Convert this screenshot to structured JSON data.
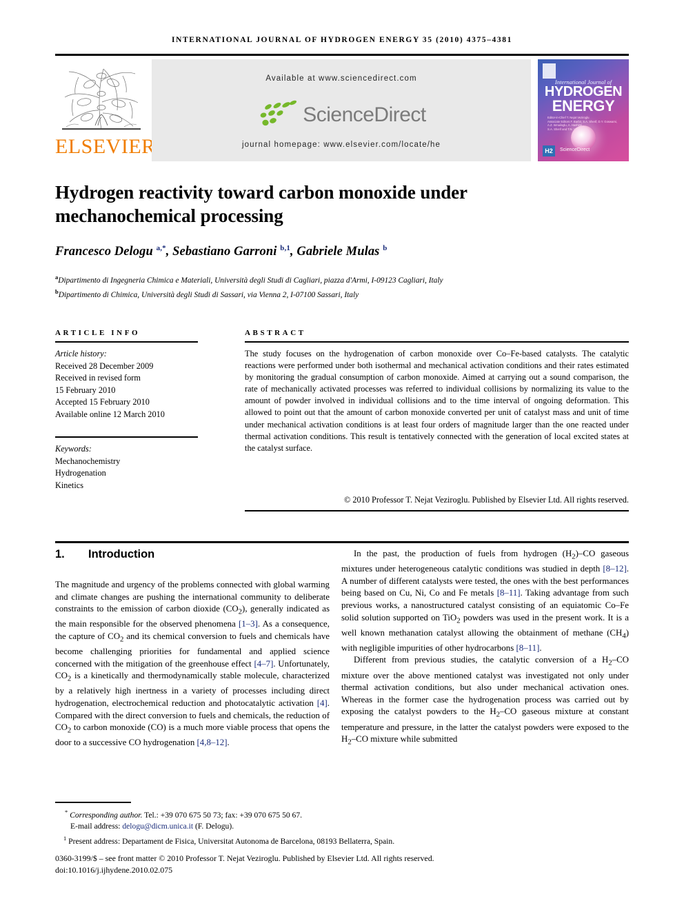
{
  "running_head": "International Journal of Hydrogen Energy 35 (2010) 4375–4381",
  "masthead": {
    "publisher_name": "ELSEVIER",
    "available_at": "Available at www.sciencedirect.com",
    "sciencedirect_label": "ScienceDirect",
    "journal_homepage": "journal homepage: www.elsevier.com/locate/he",
    "cover": {
      "line1": "International Journal of",
      "line2": "HYDROGEN",
      "line3": "ENERGY",
      "editors": "Editor-in-Chief  T. Nejat Veziroglu\nAssociate Editors  F. Barbir, S.A. Sherif, D.Y. Goswami,\nA.Z. Ismailoglu, A. Hashimi,\nS.A. Sherif and T.N. Veziroglu",
      "h2_badge": "H2",
      "sciencedirect": "ScienceDirect"
    }
  },
  "article": {
    "title": "Hydrogen reactivity toward carbon monoxide under mechanochemical processing",
    "authors_html": "Francesco Delogu <sup>a,*</sup>, Sebastiano Garroni <sup>b,1</sup>, Gabriele Mulas <sup>b</sup>",
    "affiliations": [
      {
        "marker": "a",
        "text": "Dipartimento di Ingegneria Chimica e Materiali, Università degli Studi di Cagliari, piazza d'Armi, I-09123 Cagliari, Italy"
      },
      {
        "marker": "b",
        "text": "Dipartimento di Chimica, Università degli Studi di Sassari, via Vienna 2, I-07100 Sassari, Italy"
      }
    ]
  },
  "article_info": {
    "heading": "Article info",
    "history_label": "Article history:",
    "history": [
      "Received 28 December 2009",
      "Received in revised form",
      "15 February 2010",
      "Accepted 15 February 2010",
      "Available online 12 March 2010"
    ],
    "keywords_label": "Keywords:",
    "keywords": [
      "Mechanochemistry",
      "Hydrogenation",
      "Kinetics"
    ]
  },
  "abstract": {
    "heading": "Abstract",
    "text": "The study focuses on the hydrogenation of carbon monoxide over Co–Fe-based catalysts. The catalytic reactions were performed under both isothermal and mechanical activation conditions and their rates estimated by monitoring the gradual consumption of carbon monoxide. Aimed at carrying out a sound comparison, the rate of mechanically activated processes was referred to individual collisions by normalizing its value to the amount of powder involved in individual collisions and to the time interval of ongoing deformation. This allowed to point out that the amount of carbon monoxide converted per unit of catalyst mass and unit of time under mechanical activation conditions is at least four orders of magnitude larger than the one reacted under thermal activation conditions. This result is tentatively connected with the generation of local excited states at the catalyst surface.",
    "copyright": "© 2010 Professor T. Nejat Veziroglu. Published by Elsevier Ltd. All rights reserved."
  },
  "body": {
    "section_number": "1.",
    "section_title": "Introduction",
    "left_paragraph_html": "The magnitude and urgency of the problems connected with global warming and climate changes are pushing the international community to deliberate constraints to the emission of carbon dioxide (CO<sub>2</sub>), generally indicated as the main responsible for the observed phenomena <span class=\"ref\">[1–3]</span>. As a consequence, the capture of CO<sub>2</sub> and its chemical conversion to fuels and chemicals have become challenging priorities for fundamental and applied science concerned with the mitigation of the greenhouse effect <span class=\"ref\">[4–7]</span>. Unfortunately, CO<sub>2</sub> is a kinetically and thermodynamically stable molecule, characterized by a relatively high inertness in a variety of processes including direct hydrogenation, electrochemical reduction and photocatalytic activation <span class=\"ref\">[4]</span>. Compared with the direct conversion to fuels and chemicals, the reduction of CO<sub>2</sub> to carbon monoxide (CO) is a much more viable process that opens the door to a successive CO hydrogenation <span class=\"ref\">[4,8–12]</span>.",
    "right_paragraph_1_html": "In the past, the production of fuels from hydrogen (H<sub>2</sub>)–CO gaseous mixtures under heterogeneous catalytic conditions was studied in depth <span class=\"ref\">[8–12]</span>. A number of different catalysts were tested, the ones with the best performances being based on Cu, Ni, Co and Fe metals <span class=\"ref\">[8–11]</span>. Taking advantage from such previous works, a nanostructured catalyst consisting of an equiatomic Co–Fe solid solution supported on TiO<sub>2</sub> powders was used in the present work. It is a well known methanation catalyst allowing the obtainment of methane (CH<sub>4</sub>) with negligible impurities of other hydrocarbons <span class=\"ref\">[8–11]</span>.",
    "right_paragraph_2_html": "Different from previous studies, the catalytic conversion of a H<sub>2</sub>–CO mixture over the above mentioned catalyst was investigated not only under thermal activation conditions, but also under mechanical activation ones. Whereas in the former case the hydrogenation process was carried out by exposing the catalyst powders to the H<sub>2</sub>–CO gaseous mixture at constant temperature and pressure, in the latter the catalyst powders were exposed to the H<sub>2</sub>–CO mixture while submitted"
  },
  "footnotes": {
    "corresponding_html": "<sup>*</sup> <span class=\"ital\">Corresponding author.</span> Tel.: +39 070 675 50 73; fax: +39 070 675 50 67.",
    "email_label": "E-mail address:",
    "email": "delogu@dicm.unica.it",
    "email_suffix": "(F. Delogu).",
    "present_address_html": "<sup>1</sup> Present address: Departament de Fisica, Universitat Autonoma de Barcelona, 08193 Bellaterra, Spain.",
    "front_matter": "0360-3199/$ – see front matter © 2010 Professor T. Nejat Veziroglu. Published by Elsevier Ltd. All rights reserved.",
    "doi": "doi:10.1016/j.ijhydene.2010.02.075"
  },
  "colors": {
    "elsevier_orange": "#f07d00",
    "sciencedirect_green": "#76b82a",
    "reference_blue": "#1a2c7a"
  }
}
